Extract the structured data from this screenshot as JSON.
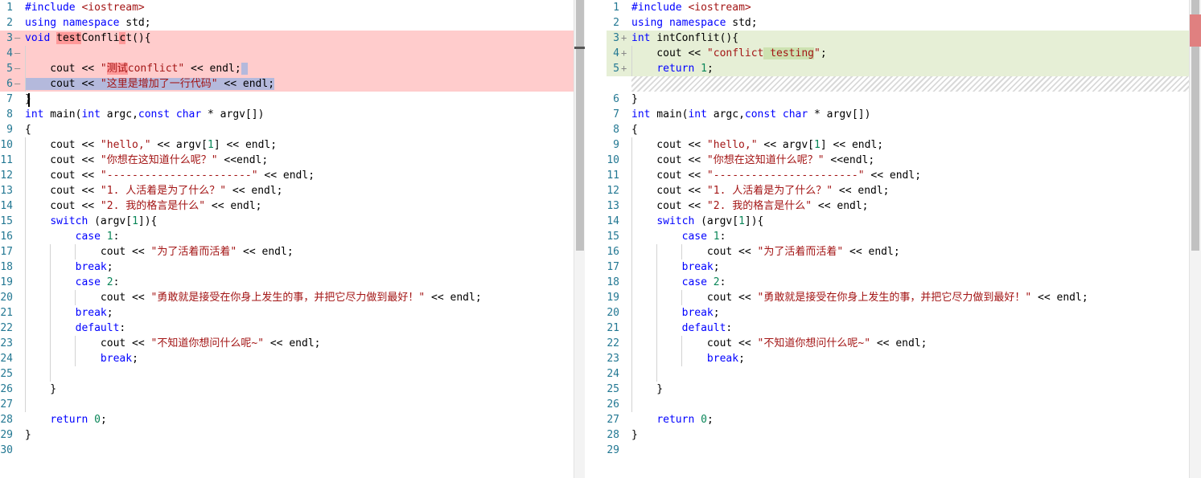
{
  "left": {
    "lines": [
      {
        "n": "1",
        "html": "<span class='pp'>#include</span> <span class='inc'>&lt;iostream&gt;</span>"
      },
      {
        "n": "2",
        "html": "<span class='kw'>using</span> <span class='kw'>namespace</span> std;"
      },
      {
        "n": "3",
        "html": "<span class='kw'>void</span> <span class='chr-del'>test</span>Confli<span class='chr-del'>c</span>t(){"
      },
      {
        "n": "4",
        "html": ""
      },
      {
        "n": "5",
        "html": "    cout &lt;&lt; <span class='str'>\"<span class='chr-del'>测试</span>conflict\"</span> &lt;&lt; endl;<span class='sel'> </span>"
      },
      {
        "n": "6",
        "html": "<span class='sel'>    cout &lt;&lt; <span class='str'>\"这里是增加了一行代码\"</span> &lt;&lt; endl;</span>"
      },
      {
        "n": "7",
        "html": "}"
      },
      {
        "n": "8",
        "html": "<span class='kw'>int</span> main(<span class='kw'>int</span> argc,<span class='kw'>const</span> <span class='kw'>char</span> * argv[])"
      },
      {
        "n": "9",
        "html": "{"
      },
      {
        "n": "10",
        "html": "    cout &lt;&lt; <span class='str'>\"hello,\"</span> &lt;&lt; argv[<span class='num'>1</span>] &lt;&lt; endl;"
      },
      {
        "n": "11",
        "html": "    cout &lt;&lt; <span class='str'>\"你想在这知道什么呢？\"</span> &lt;&lt;endl;"
      },
      {
        "n": "12",
        "html": "    cout &lt;&lt; <span class='str'>\"-----------------------\"</span> &lt;&lt; endl;"
      },
      {
        "n": "13",
        "html": "    cout &lt;&lt; <span class='str'>\"1. 人活着是为了什么？\"</span> &lt;&lt; endl;"
      },
      {
        "n": "14",
        "html": "    cout &lt;&lt; <span class='str'>\"2. 我的格言是什么\"</span> &lt;&lt; endl;"
      },
      {
        "n": "15",
        "html": "    <span class='kw'>switch</span> (argv[<span class='num'>1</span>]){"
      },
      {
        "n": "16",
        "html": "        <span class='kw'>case</span> <span class='num'>1</span>:"
      },
      {
        "n": "17",
        "html": "            cout &lt;&lt; <span class='str'>\"为了活着而活着\"</span> &lt;&lt; endl;"
      },
      {
        "n": "18",
        "html": "        <span class='kw'>break</span>;"
      },
      {
        "n": "19",
        "html": "        <span class='kw'>case</span> <span class='num'>2</span>:"
      },
      {
        "n": "20",
        "html": "            cout &lt;&lt; <span class='str'>\"勇敢就是接受在你身上发生的事，并把它尽力做到最好！\"</span> &lt;&lt; endl;"
      },
      {
        "n": "21",
        "html": "        <span class='kw'>break</span>;"
      },
      {
        "n": "22",
        "html": "        <span class='kw'>default</span>:"
      },
      {
        "n": "23",
        "html": "            cout &lt;&lt; <span class='str'>\"不知道你想问什么呢~\"</span> &lt;&lt; endl;"
      },
      {
        "n": "24",
        "html": "            <span class='kw'>break</span>;"
      },
      {
        "n": "25",
        "html": ""
      },
      {
        "n": "26",
        "html": "    }"
      },
      {
        "n": "27",
        "html": ""
      },
      {
        "n": "28",
        "html": "    <span class='kw'>return</span> <span class='num'>0</span>;"
      },
      {
        "n": "29",
        "html": "}"
      },
      {
        "n": "30",
        "html": ""
      }
    ],
    "gutter_marks": [
      {
        "line": 3,
        "sym": "—"
      },
      {
        "line": 4,
        "sym": "—"
      },
      {
        "line": 5,
        "sym": "—"
      },
      {
        "line": 6,
        "sym": "—"
      }
    ]
  },
  "right": {
    "lines": [
      {
        "n": "1",
        "html": "<span class='pp'>#include</span> <span class='inc'>&lt;iostream&gt;</span>"
      },
      {
        "n": "2",
        "html": "<span class='kw'>using</span> <span class='kw'>namespace</span> std;"
      },
      {
        "n": "3",
        "html": "<span class='kw'>int</span> intConflit(){"
      },
      {
        "n": "4",
        "html": "    cout &lt;&lt; <span class='str'>\"conflict<span class='chr-ins'> testing</span>\"</span>;"
      },
      {
        "n": "5",
        "html": "    <span class='kw'>return</span> <span class='num'>1</span>;"
      },
      {
        "n": "",
        "html": ""
      },
      {
        "n": "6",
        "html": "}"
      },
      {
        "n": "7",
        "html": "<span class='kw'>int</span> main(<span class='kw'>int</span> argc,<span class='kw'>const</span> <span class='kw'>char</span> * argv[])"
      },
      {
        "n": "8",
        "html": "{"
      },
      {
        "n": "9",
        "html": "    cout &lt;&lt; <span class='str'>\"hello,\"</span> &lt;&lt; argv[<span class='num'>1</span>] &lt;&lt; endl;"
      },
      {
        "n": "10",
        "html": "    cout &lt;&lt; <span class='str'>\"你想在这知道什么呢？\"</span> &lt;&lt;endl;"
      },
      {
        "n": "11",
        "html": "    cout &lt;&lt; <span class='str'>\"-----------------------\"</span> &lt;&lt; endl;"
      },
      {
        "n": "12",
        "html": "    cout &lt;&lt; <span class='str'>\"1. 人活着是为了什么？\"</span> &lt;&lt; endl;"
      },
      {
        "n": "13",
        "html": "    cout &lt;&lt; <span class='str'>\"2. 我的格言是什么\"</span> &lt;&lt; endl;"
      },
      {
        "n": "14",
        "html": "    <span class='kw'>switch</span> (argv[<span class='num'>1</span>]){"
      },
      {
        "n": "15",
        "html": "        <span class='kw'>case</span> <span class='num'>1</span>:"
      },
      {
        "n": "16",
        "html": "            cout &lt;&lt; <span class='str'>\"为了活着而活着\"</span> &lt;&lt; endl;"
      },
      {
        "n": "17",
        "html": "        <span class='kw'>break</span>;"
      },
      {
        "n": "18",
        "html": "        <span class='kw'>case</span> <span class='num'>2</span>:"
      },
      {
        "n": "19",
        "html": "            cout &lt;&lt; <span class='str'>\"勇敢就是接受在你身上发生的事，并把它尽力做到最好！\"</span> &lt;&lt; endl;"
      },
      {
        "n": "20",
        "html": "        <span class='kw'>break</span>;"
      },
      {
        "n": "21",
        "html": "        <span class='kw'>default</span>:"
      },
      {
        "n": "22",
        "html": "            cout &lt;&lt; <span class='str'>\"不知道你想问什么呢~\"</span> &lt;&lt; endl;"
      },
      {
        "n": "23",
        "html": "            <span class='kw'>break</span>;"
      },
      {
        "n": "24",
        "html": ""
      },
      {
        "n": "25",
        "html": "    }"
      },
      {
        "n": "26",
        "html": ""
      },
      {
        "n": "27",
        "html": "    <span class='kw'>return</span> <span class='num'>0</span>;"
      },
      {
        "n": "28",
        "html": "}"
      },
      {
        "n": "29",
        "html": ""
      }
    ],
    "gutter_marks": [
      {
        "line": 3,
        "sym": "+"
      },
      {
        "line": 4,
        "sym": "+"
      },
      {
        "line": 5,
        "sym": "+"
      }
    ]
  },
  "colors": {
    "deleted_bg": "#ffcccc",
    "inserted_bg": "#e6efd6",
    "keyword": "#0000ff",
    "string": "#a31515",
    "number": "#098658",
    "line_number": "#237893"
  }
}
